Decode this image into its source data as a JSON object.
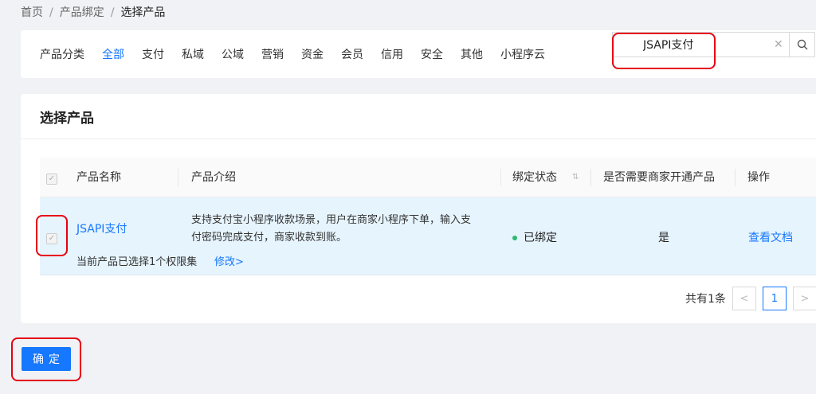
{
  "breadcrumb": {
    "items": [
      "首页",
      "产品绑定"
    ],
    "current": "选择产品"
  },
  "categories": {
    "label": "产品分类",
    "items": [
      "全部",
      "支付",
      "私域",
      "公域",
      "营销",
      "资金",
      "会员",
      "信用",
      "安全",
      "其他",
      "小程序云"
    ],
    "active": "全部"
  },
  "search": {
    "value": "JSAPI支付",
    "clear_icon": "close-icon",
    "button_icon": "search-icon"
  },
  "product_card": {
    "title": "选择产品",
    "columns": [
      "产品名称",
      "产品介绍",
      "绑定状态",
      "是否需要商家开通产品",
      "操作"
    ],
    "rows": [
      {
        "name": "JSAPI支付",
        "intro_line1": "支持支付宝小程序收款场景，用户在商家小程序下单，输入支",
        "intro_line2": "付密码完成支付，商家收款到账。",
        "permission_text": "当前产品已选择1个权限集",
        "modify_label": "修改>",
        "status": "已绑定",
        "needs_activation": "是",
        "action": "查看文档",
        "selected": true
      }
    ],
    "pagination": {
      "total": "共有1条",
      "current_page": "1",
      "prev": "<",
      "next": ">"
    }
  },
  "confirm_label": "确定",
  "colors": {
    "accent": "#1677ff",
    "highlight": "#e60012",
    "status_green": "#2eb872",
    "row_bg": "#e6f4fd"
  }
}
